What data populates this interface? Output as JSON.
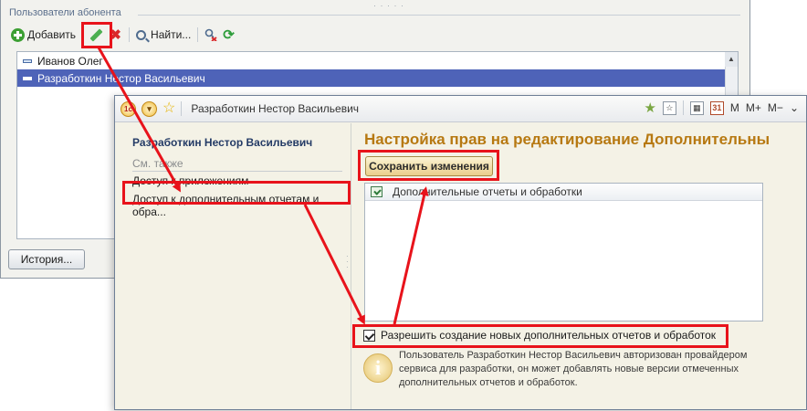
{
  "background_window": {
    "group_title": "Пользователи абонента",
    "toolbar": {
      "add_label": "Добавить",
      "find_label": "Найти..."
    },
    "users": [
      {
        "name": "Иванов Олег",
        "selected": false
      },
      {
        "name": "Разработкин Нестор Васильевич",
        "selected": true
      }
    ],
    "history_label": "История..."
  },
  "front_window": {
    "title": "Разработкин Нестор Васильевич",
    "logo_text": "1с",
    "title_right": {
      "m_label": "M",
      "m_plus_label": "M+",
      "m_minus_label": "M−",
      "calendar_icon": "31"
    },
    "left_panel": {
      "title": "Разработкин Нестор Васильевич",
      "see_also": "См. также",
      "links": [
        "Доступ к приложениям",
        "Доступ к дополнительным отчетам и обра..."
      ]
    },
    "right_panel": {
      "heading": "Настройка прав на редактирование Дополнительны",
      "save_label": "Сохранить изменения",
      "table_header": "Дополнительные отчеты и обработки",
      "allow_label": "Разрешить создание новых дополнительных отчетов и обработок",
      "allow_checked": true,
      "info_text": "Пользователь Разработкин Нестор Васильевич авторизован провайдером сервиса для разработки, он может добавлять новые версии отмеченных дополнительных отчетов и обработок."
    }
  },
  "annotation_color": "#e8131b"
}
